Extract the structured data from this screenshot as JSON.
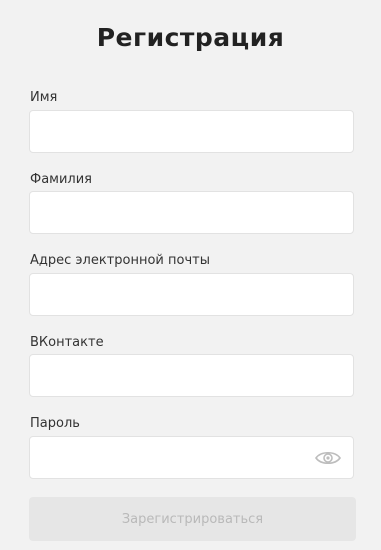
{
  "form": {
    "title": "Регистрация",
    "fields": [
      {
        "label": "Имя",
        "value": "",
        "placeholder": ""
      },
      {
        "label": "Фамилия",
        "value": "",
        "placeholder": ""
      },
      {
        "label": "Адрес электронной почты",
        "value": "",
        "placeholder": ""
      },
      {
        "label": "ВКонтакте",
        "value": "",
        "placeholder": ""
      },
      {
        "label": "Пароль",
        "value": "",
        "placeholder": ""
      }
    ],
    "password_toggle_icon": "eye-icon",
    "submit_label": "Зарегистрироваться"
  },
  "colors": {
    "background": "#f2f2f2",
    "input_background": "#ffffff",
    "input_border": "#e2e2e2",
    "button_disabled_background": "#e6e6e6",
    "button_disabled_text": "#b9b9b9",
    "title_text": "#222222"
  }
}
